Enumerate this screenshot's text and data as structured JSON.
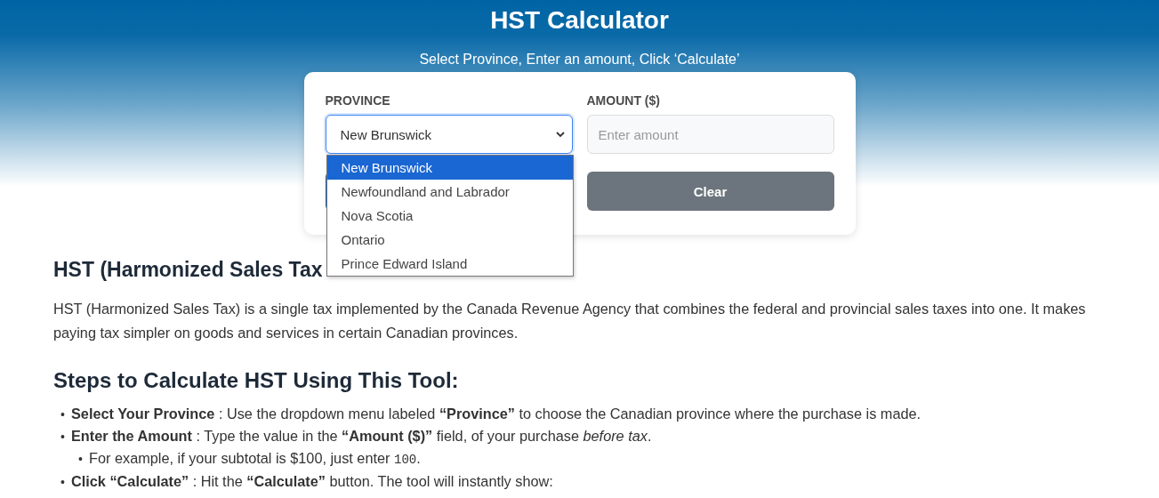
{
  "header": {
    "title": "HST Calculator",
    "subtitle": "Select Province, Enter an amount, Click ‘Calculate’"
  },
  "form": {
    "province": {
      "label": "PROVINCE",
      "value": "New Brunswick",
      "expanded": true,
      "options": [
        {
          "label": "New Brunswick",
          "selected": true
        },
        {
          "label": "Newfoundland and Labrador",
          "selected": false
        },
        {
          "label": "Nova Scotia",
          "selected": false
        },
        {
          "label": "Ontario",
          "selected": false
        },
        {
          "label": "Prince Edward Island",
          "selected": false
        }
      ]
    },
    "amount": {
      "label": "AMOUNT ($)",
      "placeholder": "Enter amount"
    },
    "buttons": [
      {
        "kind": "primary"
      },
      {
        "kind": "secondary",
        "label": "Clear"
      }
    ]
  },
  "content": {
    "heading": "HST (Harmonized Sales Tax",
    "paragraph": "HST (Harmonized Sales Tax) is a single tax implemented by the Canada Revenue Agency that combines the federal and provincial sales taxes into one. It makes paying tax simpler on goods and services in certain Canadian provinces.",
    "steps_heading": "Steps to Calculate HST Using This Tool:",
    "steps": [
      {
        "marker": "•",
        "text": "**Select Your Province** : Use the dropdown menu labeled **“Province”** to choose the Canadian province where the purchase is made."
      },
      {
        "marker": "•",
        "text": "**Enter the Amount** : Type the value in the **“Amount ($)”** field, of your purchase *before tax*.",
        "children": [
          {
            "marker": "•",
            "text": "For example, if your subtotal is $100, just enter ",
            "code": "100",
            "after": "."
          }
        ]
      },
      {
        "marker": "•",
        "text": "**Click “Calculate”** : Hit the **“Calculate”** button. The tool will instantly show:"
      }
    ]
  }
}
